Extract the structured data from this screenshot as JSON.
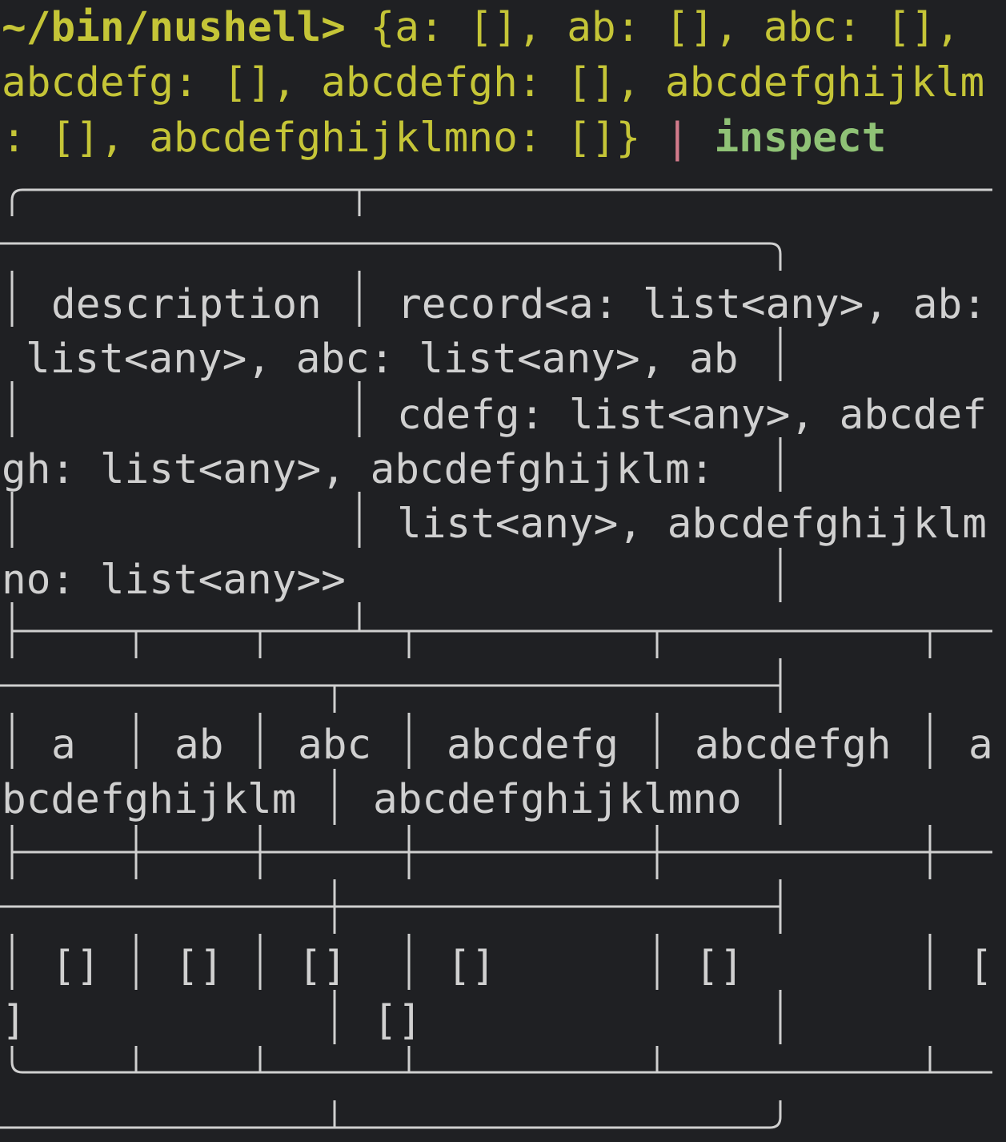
{
  "prompt": {
    "path": "~/bin/nushell>"
  },
  "command": {
    "line1": " {a: [], ab: [], abc: [],",
    "line2": "abcdefg: [], abcdefgh: [], abcdefghijklm",
    "line3_rest": ": [], abcdefghijklmno: []}",
    "pipe": "|",
    "cmd": "inspect"
  },
  "table": {
    "description_label": "description",
    "type_lines": [
      "record<a: list<any>, ab:",
      "list<any>, abc: list<any>, ab",
      "cdefg: list<any>, abcdef",
      "gh: list<any>, abcdefghijklm:",
      "list<any>, abcdefghijklm",
      "no: list<any>>"
    ],
    "headers": [
      "a",
      "ab",
      "abc",
      "abcdefg",
      "abcdefgh",
      "a"
    ],
    "headers_wrap": [
      "bcdefghijklm",
      "abcdefghijklmno"
    ],
    "values": [
      "[]",
      "[]",
      "[]",
      "[]",
      "[]",
      "["
    ],
    "values_wrap": [
      "]",
      "[]"
    ]
  }
}
